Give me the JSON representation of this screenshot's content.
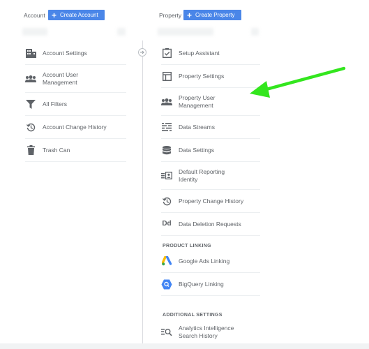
{
  "account_column": {
    "label": "Account",
    "create_button": "Create Account",
    "items": [
      {
        "label": "Account Settings",
        "icon": "building-icon"
      },
      {
        "label": "Account User Management",
        "icon": "people-icon"
      },
      {
        "label": "All Filters",
        "icon": "filter-icon"
      },
      {
        "label": "Account Change History",
        "icon": "history-icon"
      },
      {
        "label": "Trash Can",
        "icon": "trash-icon"
      }
    ]
  },
  "property_column": {
    "label": "Property",
    "create_button": "Create Property",
    "items": [
      {
        "label": "Setup Assistant",
        "icon": "checklist-icon"
      },
      {
        "label": "Property Settings",
        "icon": "layout-icon"
      },
      {
        "label": "Property User Management",
        "icon": "people-icon"
      },
      {
        "label": "Data Streams",
        "icon": "streams-icon"
      },
      {
        "label": "Data Settings",
        "icon": "database-icon"
      },
      {
        "label": "Default Reporting Identity",
        "icon": "identity-icon"
      },
      {
        "label": "Property Change History",
        "icon": "history-icon"
      },
      {
        "label": "Data Deletion Requests",
        "icon": "dd-icon"
      }
    ],
    "product_linking": {
      "heading": "PRODUCT LINKING",
      "items": [
        {
          "label": "Google Ads Linking",
          "icon": "google-ads-icon"
        },
        {
          "label": "BigQuery Linking",
          "icon": "bigquery-icon"
        }
      ]
    },
    "additional_settings": {
      "heading": "ADDITIONAL SETTINGS",
      "items": [
        {
          "label": "Analytics Intelligence Search History",
          "icon": "search-history-icon"
        }
      ]
    }
  },
  "colors": {
    "button_blue": "#4a86e8",
    "arrow_green": "#33e61e",
    "icon_gray": "#5f6368"
  },
  "annotation": {
    "type": "arrow",
    "points_to": "Property User Management"
  }
}
